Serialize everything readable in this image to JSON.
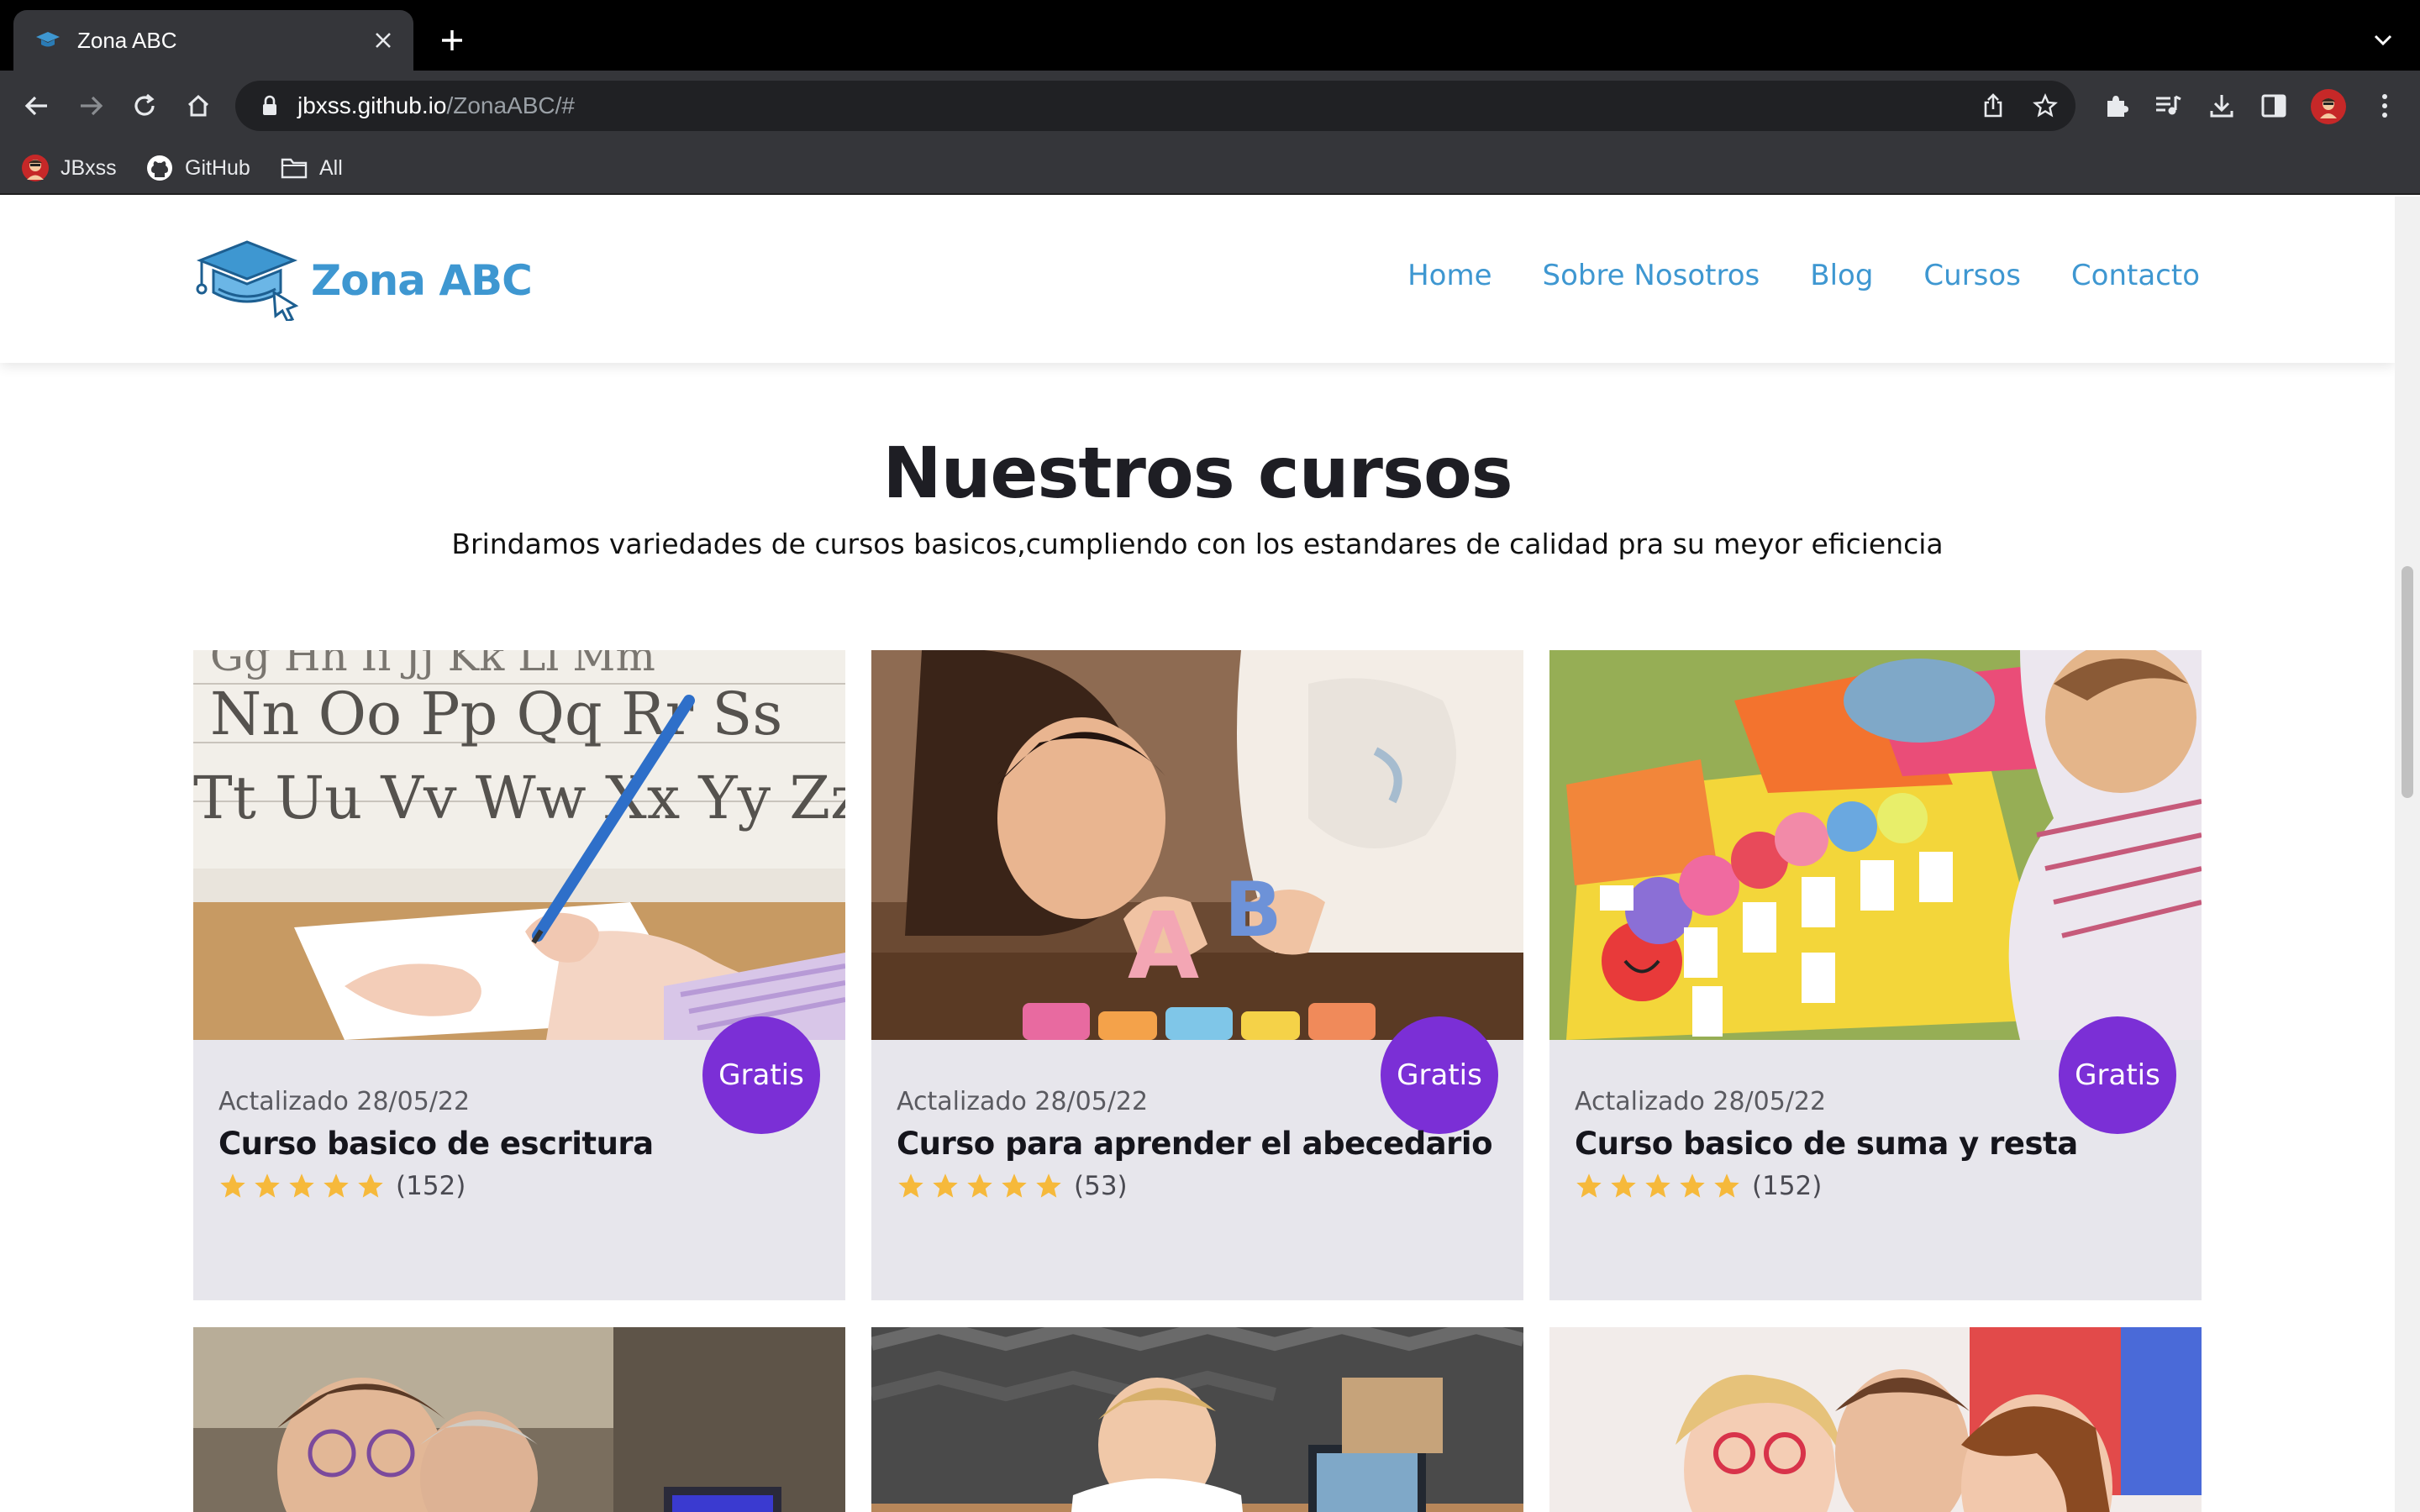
{
  "browser": {
    "tab_title": "Zona ABC",
    "url_host": "jbxss.github.io",
    "url_path": "/ZonaABC/#",
    "bookmarks": [
      {
        "label": "JBxss",
        "icon": "avatar-icon"
      },
      {
        "label": "GitHub",
        "icon": "github-icon"
      },
      {
        "label": "All",
        "icon": "folder-icon"
      }
    ]
  },
  "site": {
    "logo_text": "Zona ABC",
    "nav": [
      "Home",
      "Sobre Nosotros",
      "Blog",
      "Cursos",
      "Contacto"
    ],
    "brand_color": "#3e97d1",
    "badge_color": "#7b2fd6"
  },
  "courses_section": {
    "title": "Nuestros cursos",
    "subtitle": "Brindamos variedades de cursos basicos,cumpliendo con los estandares de calidad pra su meyor eficiencia"
  },
  "courses": [
    {
      "badge": "Gratis",
      "date": "Actalizado 28/05/22",
      "title": "Curso basico de escritura",
      "stars": 5,
      "count": "(152)",
      "image": "child-writing-photo"
    },
    {
      "badge": "Gratis",
      "date": "Actalizado 28/05/22",
      "title": "Curso para aprender el abecedario",
      "stars": 5,
      "count": "(53)",
      "image": "alphabet-blocks-photo"
    },
    {
      "badge": "Gratis",
      "date": "Actalizado 28/05/22",
      "title": "Curso basico de suma y resta",
      "stars": 5,
      "count": "(152)",
      "image": "math-crafts-photo"
    }
  ]
}
